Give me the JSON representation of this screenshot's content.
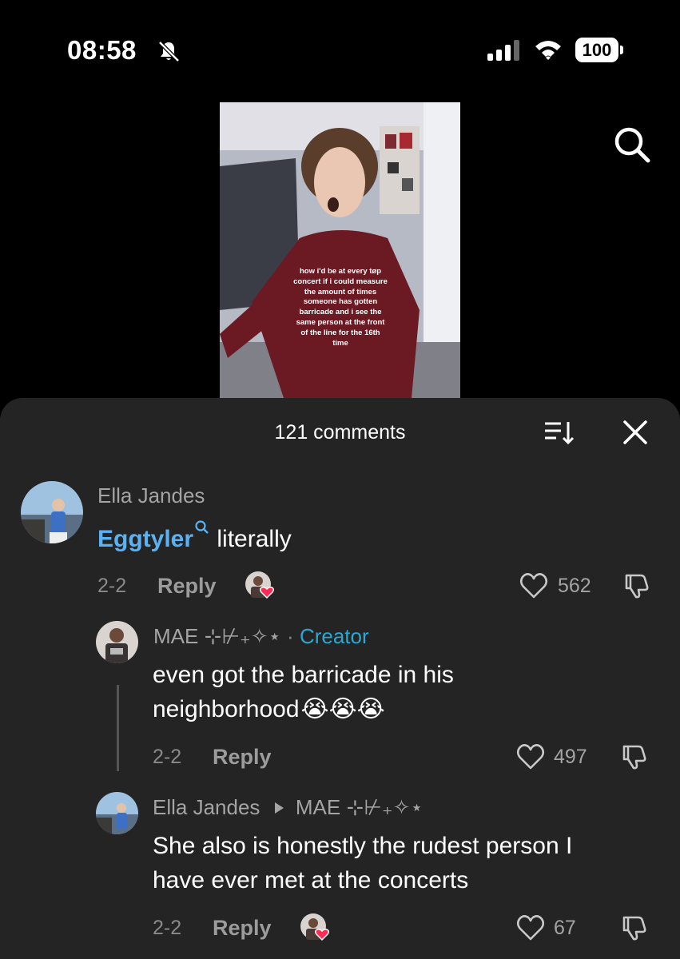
{
  "status_bar": {
    "time": "08:58",
    "battery": "100",
    "icons": [
      "bell-slash-icon",
      "cellular-signal-icon",
      "wifi-icon",
      "battery-icon"
    ]
  },
  "video": {
    "caption": "how i'd be at every tøp concert if i could measure the amount of times someone has gotten barricade and i see the same person at the front of the line for the 16th time"
  },
  "sheet": {
    "title": "121 comments",
    "icons": [
      "sort-icon",
      "close-icon"
    ]
  },
  "comments": [
    {
      "username": "Ella Jandes",
      "mention": "Eggtyler",
      "text": "literally",
      "date": "2-2",
      "reply_label": "Reply",
      "likes": "562"
    },
    {
      "username": "MAE ⊹⊬₊✧⋆",
      "separator": "·",
      "creator_label": "Creator",
      "text_line1": "even got the barricade in his",
      "text_line2": "neighborhood",
      "emojis": "😭😭😭",
      "date": "2-2",
      "reply_label": "Reply",
      "likes": "497"
    },
    {
      "username": "Ella Jandes",
      "reply_to": "MAE ⊹⊬₊✧⋆",
      "text_line1": "She also is honestly the rudest person I",
      "text_line2": "have ever met at the concerts",
      "date": "2-2",
      "reply_label": "Reply",
      "likes": "67"
    }
  ],
  "colors": {
    "sheet_bg": "#242424",
    "mention": "#5bb2f3",
    "creator": "#2aa8d2",
    "heart_badge": "#fe2c55"
  }
}
